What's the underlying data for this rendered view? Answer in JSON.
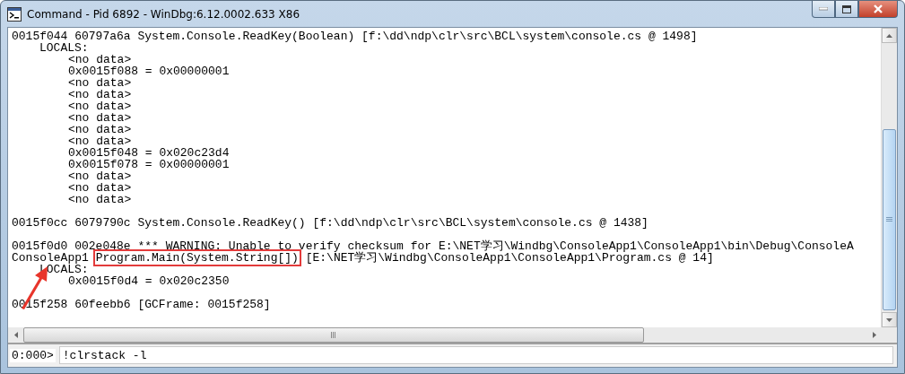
{
  "window": {
    "title": "Command - Pid 6892 - WinDbg:6.12.0002.633 X86"
  },
  "output": {
    "frames": [
      {
        "lines": [
          [
            {
              "text": "0015f044 60797a6a System.Console.ReadKey(Boolean) [f:\\dd\\ndp\\clr\\src\\BCL\\system\\console.cs @ 1498]",
              "boxed": false
            }
          ]
        ],
        "locals": {
          "label": "LOCALS:",
          "values": [
            "<no data>",
            "0x0015f088 = 0x00000001",
            "<no data>",
            "<no data>",
            "<no data>",
            "<no data>",
            "<no data>",
            "<no data>",
            "0x0015f048 = 0x020c23d4",
            "0x0015f078 = 0x00000001",
            "<no data>",
            "<no data>",
            "<no data>"
          ]
        }
      },
      {
        "lines": [
          [
            {
              "text": "0015f0cc 6079790c System.Console.ReadKey() [f:\\dd\\ndp\\clr\\src\\BCL\\system\\console.cs @ 1438]",
              "boxed": false
            }
          ]
        ]
      },
      {
        "lines": [
          [
            {
              "text": "0015f0d0 002e048e *** WARNING: Unable to verify checksum for E:\\NET学习\\Windbg\\ConsoleApp1\\ConsoleApp1\\bin\\Debug\\ConsoleA",
              "boxed": false
            }
          ],
          [
            {
              "text": "ConsoleApp1",
              "boxed": false
            },
            {
              "text": "Program.Main(System.String[])",
              "boxed": true
            },
            {
              "text": "[E:\\NET学习\\Windbg\\ConsoleApp1\\ConsoleApp1\\Program.cs @ 14]",
              "boxed": false
            }
          ]
        ],
        "locals": {
          "label": "LOCALS:",
          "values": [
            "0x0015f0d4 = 0x020c2350"
          ]
        },
        "arrow": true
      },
      {
        "lines": [
          [
            {
              "text": "0015f258 60feebb6 [GCFrame: 0015f258]",
              "boxed": false
            }
          ]
        ]
      }
    ]
  },
  "command": {
    "prompt": "0:000>",
    "value": "!clrstack -l"
  }
}
